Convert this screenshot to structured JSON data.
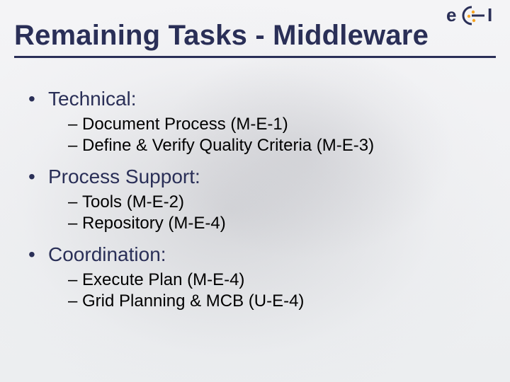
{
  "logo": {
    "name": "EGI"
  },
  "title": "Remaining Tasks - Middleware",
  "sections": [
    {
      "heading": "Technical:",
      "items": [
        "Document Process (M-E-1)",
        "Define & Verify Quality Criteria (M-E-3)"
      ]
    },
    {
      "heading": "Process Support:",
      "items": [
        "Tools (M-E-2)",
        "Repository (M-E-4)"
      ]
    },
    {
      "heading": "Coordination:",
      "items": [
        "Execute Plan (M-E-4)",
        "Grid Planning & MCB (U-E-4)"
      ]
    }
  ]
}
